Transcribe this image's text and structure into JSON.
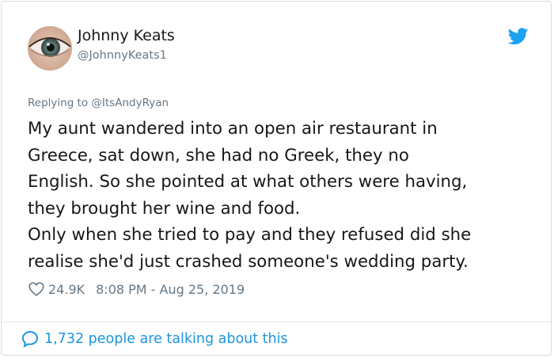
{
  "author": {
    "name": "Johnny Keats",
    "handle": "@JohnnyKeats1",
    "avatar_icon": "eye-avatar"
  },
  "brand": {
    "icon": "twitter-bird-icon",
    "color": "#1da1f2"
  },
  "reply": {
    "prefix": "Replying to ",
    "mention": "@ItsAndyRyan"
  },
  "tweet": {
    "text": "My aunt wandered into an open air restaurant in\nGreece, sat down, she had no Greek, they no\nEnglish. So she pointed at what others were having,\nthey brought her wine and food.\nOnly when she tried to pay and they refused did she\nrealise she'd just crashed someone's wedding party."
  },
  "meta": {
    "likes": "24.9K",
    "timestamp": "8:08 PM - Aug 25, 2019",
    "heart_icon": "heart-icon"
  },
  "footer": {
    "talking": "1,732 people are talking about this",
    "bubble_icon": "comment-bubble-icon",
    "link_color": "#1b95e0"
  }
}
